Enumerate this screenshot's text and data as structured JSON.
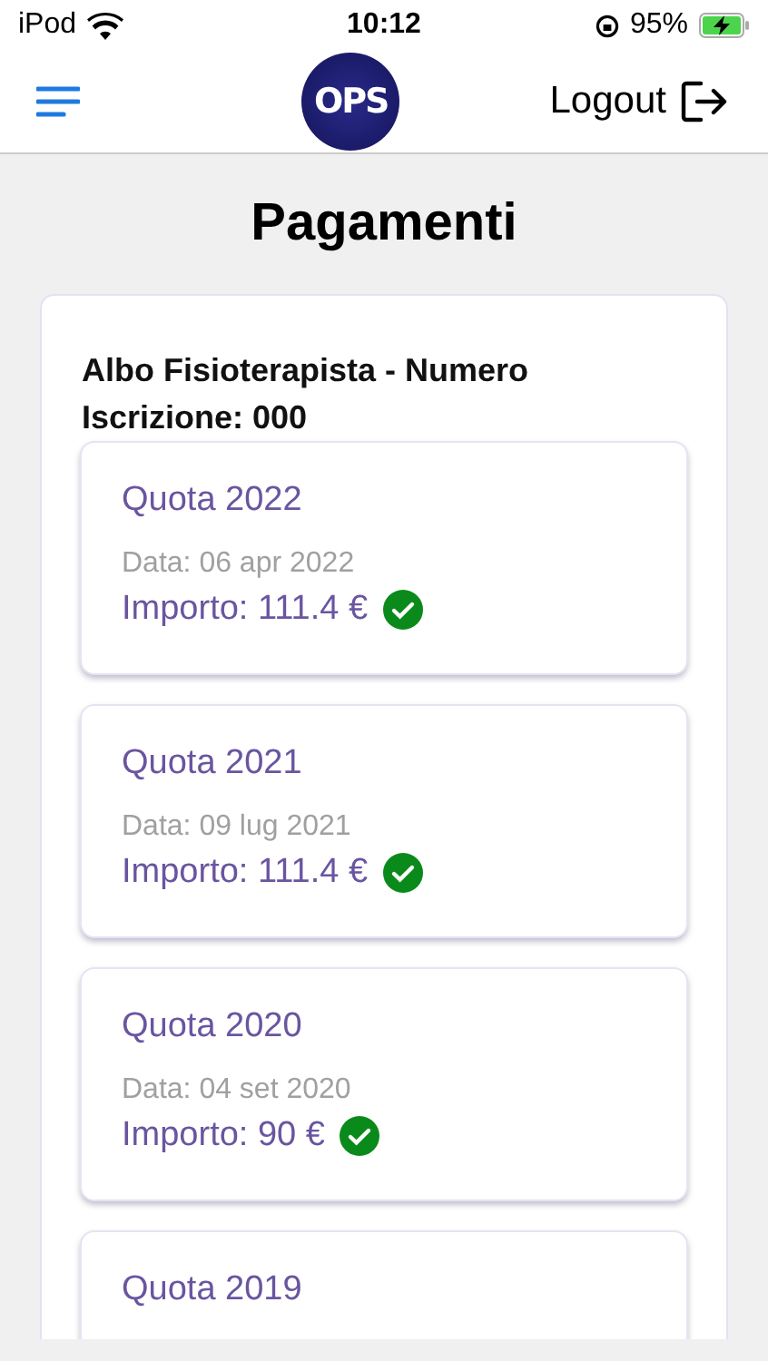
{
  "status_bar": {
    "carrier": "iPod",
    "time": "10:12",
    "battery": "95%"
  },
  "header": {
    "logo_text": "OPS",
    "logout_label": "Logout"
  },
  "title": "Pagamenti",
  "register": {
    "heading": "Albo Fisioterapista - Numero Iscrizione: 000"
  },
  "payments": [
    {
      "title": "Quota 2022",
      "date": "Data: 06 apr 2022",
      "amount": "Importo: 111.4 €",
      "paid": true
    },
    {
      "title": "Quota 2021",
      "date": "Data: 09 lug 2021",
      "amount": "Importo: 111.4 €",
      "paid": true
    },
    {
      "title": "Quota 2020",
      "date": "Data: 04 set 2020",
      "amount": "Importo: 90 €",
      "paid": true
    },
    {
      "title": "Quota 2019"
    }
  ]
}
